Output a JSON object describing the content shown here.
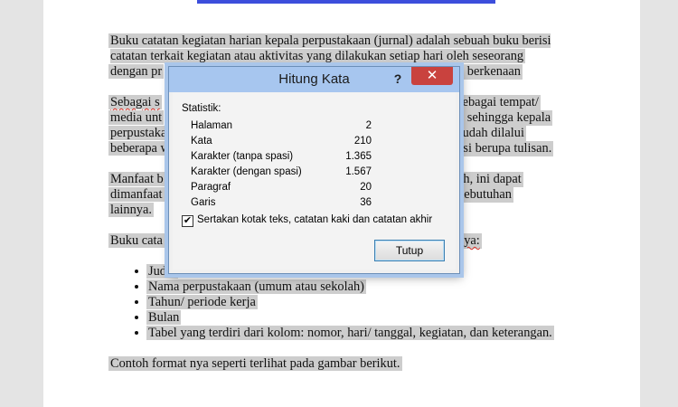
{
  "document": {
    "p1": "Buku catatan kegiatan harian kepala perpustakaan (jurnal) adalah sebuah buku berisi catatan terkait kegiatan atau aktivitas yang dilakukan setiap hari oleh seseorang",
    "p1_tail": "n berkenaan",
    "p1_end": "dengan pr",
    "p2_start": "Sebagai s",
    "p2_r1": "sebagai tempat/",
    "p2_l2": "media unt",
    "p2_r2": "h sehingga kepala",
    "p2_l3": "perpustaka",
    "p2_r3": "sudah dilalui",
    "p2_l4": "beberapa w",
    "p2_r4": "asi berupa tulisan.",
    "p3_l1": "Manfaat b",
    "p3_r1": "ah, ini dapat",
    "p3_l2": "dimanfaat",
    "p3_r2": "kebutuhan",
    "p3_l3": "lainnya.",
    "p4_l": "Buku cata",
    "p4_r": "nya:",
    "list": [
      "Judul",
      "Nama perpustakaan (umum atau sekolah)",
      "Tahun/ periode kerja",
      "Bulan",
      "Tabel yang terdiri dari kolom: nomor, hari/ tanggal, kegiatan, dan keterangan."
    ],
    "p5": "Contoh format nya seperti terlihat pada gambar berikut."
  },
  "dialog": {
    "title": "Hitung Kata",
    "help_label": "?",
    "close_label": "✕",
    "section_label": "Statistik:",
    "stats": [
      {
        "name": "Halaman",
        "value": "2"
      },
      {
        "name": "Kata",
        "value": "210"
      },
      {
        "name": "Karakter (tanpa spasi)",
        "value": "1.365"
      },
      {
        "name": "Karakter (dengan spasi)",
        "value": "1.567"
      },
      {
        "name": "Paragraf",
        "value": "20"
      },
      {
        "name": "Garis",
        "value": "36"
      }
    ],
    "checkbox_checked": true,
    "checkbox_label": "Sertakan kotak teks, catatan kaki dan catatan akhir",
    "button_label": "Tutup"
  }
}
